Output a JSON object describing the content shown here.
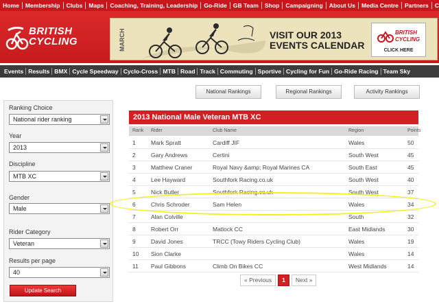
{
  "top_nav": [
    "Home",
    "Membership",
    "Clubs",
    "Maps",
    "Coaching, Training, Leadership",
    "Go-Ride",
    "GB Team",
    "Shop",
    "Campaigning",
    "About Us",
    "Media Centre",
    "Partners",
    "Contact"
  ],
  "logo": {
    "line1": "BRITISH",
    "line2": "CYCLING"
  },
  "banner": {
    "month": "MARCH",
    "line1": "VISIT OUR 2013",
    "line2": "EVENTS CALENDAR",
    "promo_line1": "BRITISH",
    "promo_line2": "CYCLING",
    "click": "CLICK HERE"
  },
  "sub_nav": [
    "Events",
    "Results",
    "BMX",
    "Cycle Speedway",
    "Cyclo-Cross",
    "MTB",
    "Road",
    "Track",
    "Commuting",
    "Sportive",
    "Cycling for Fun",
    "Go-Ride Racing",
    "Team Sky"
  ],
  "ranking_buttons": [
    "National Rankings",
    "Regional Rankings",
    "Activity Rankings"
  ],
  "sidebar": {
    "fields": [
      {
        "label": "Ranking Choice",
        "value": "National rider ranking"
      },
      {
        "label": "Year",
        "value": "2013"
      },
      {
        "label": "Discipline",
        "value": "MTB XC"
      },
      {
        "label": "Gender",
        "value": "Male"
      },
      {
        "label": "Rider Category",
        "value": "Veteran"
      },
      {
        "label": "Results per page",
        "value": "40"
      }
    ],
    "update_label": "Update Search"
  },
  "table": {
    "title": "2013 National Male Veteran MTB XC",
    "headers": [
      "Rank",
      "Rider",
      "Club Name",
      "Region",
      "Points"
    ],
    "rows": [
      [
        "1",
        "Mark Spratt",
        "Cardiff JIF",
        "Wales",
        "50"
      ],
      [
        "2",
        "Gary Andrews",
        "Certini",
        "South West",
        "45"
      ],
      [
        "3",
        "Matthew Craner",
        "Royal Navy &amp; Royal Marines CA",
        "South East",
        "45"
      ],
      [
        "4",
        "Lee  Hayward",
        "Southfork Racing.co.uk",
        "South West",
        "40"
      ],
      [
        "5",
        "Nick Butler",
        "Southfork Racing.co.uk",
        "South West",
        "37"
      ],
      [
        "6",
        "Chris Schroder",
        "Sam Helen",
        "Wales",
        "34"
      ],
      [
        "7",
        "Alan Colville",
        "",
        "South",
        "32"
      ],
      [
        "8",
        "Robert Orr",
        "Matlock CC",
        "East Midlands",
        "30"
      ],
      [
        "9",
        "David Jones",
        "TRCC (Towy Riders Cycling Club)",
        "Wales",
        "19"
      ],
      [
        "10",
        "Sion Clarke",
        "",
        "Wales",
        "14"
      ],
      [
        "11",
        "Paul Gibbons",
        "Climb On Bikes CC",
        "West Midlands",
        "14"
      ]
    ]
  },
  "pagination": {
    "prev": "« Previous",
    "current": "1",
    "next": "Next »"
  },
  "colors": {
    "brand_red": "#c8161d",
    "nav_dark": "#3c3c3c",
    "highlight_yellow": "#f5f01a"
  }
}
